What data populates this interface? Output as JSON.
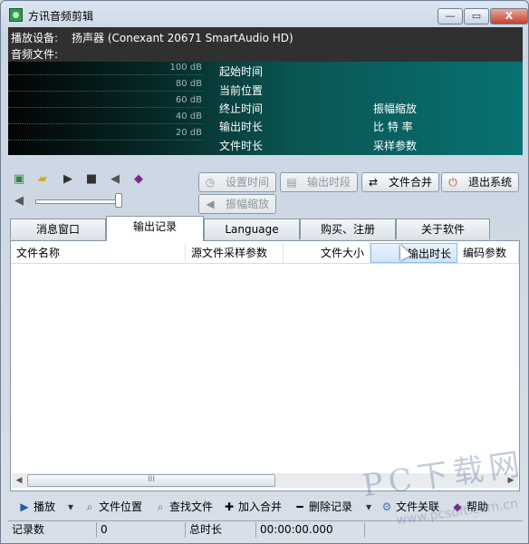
{
  "window": {
    "title": "方讯音频剪辑",
    "min_label": "—",
    "max_label": "▭",
    "close_label": "X"
  },
  "info": {
    "device_label": "播放设备:",
    "device_value": "扬声器 (Conexant 20671 SmartAudio HD)",
    "file_label": "音频文件:"
  },
  "meter": {
    "scale": [
      "100 dB",
      "80 dB",
      "60 dB",
      "40 dB",
      "20 dB"
    ],
    "left_labels": [
      "起始时间",
      "当前位置",
      "终止时间",
      "输出时长",
      "文件时长"
    ],
    "right_labels": [
      "振幅缩放",
      "比 特 率",
      "采样参数"
    ]
  },
  "toolbar": {
    "icons": [
      "monitor-icon",
      "folder-icon",
      "play-icon",
      "stop-icon",
      "speaker-icon",
      "book-icon"
    ],
    "volume_level": 0.95,
    "buttons": {
      "set_range": "设置时间段",
      "output_range": "输出时段",
      "merge": "文件合并",
      "exit": "退出系统",
      "amplitude": "振幅缩放"
    }
  },
  "tabs": [
    "消息窗口",
    "输出记录",
    "Language",
    "购买、注册",
    "关于软件"
  ],
  "active_tab": 1,
  "columns": [
    "文件名称",
    "源文件采样参数",
    "文件大小",
    "输出时长",
    "编码参数"
  ],
  "scroll_grip": "III",
  "bottom_toolbar": {
    "play": "播放",
    "file_location": "文件位置",
    "find_file": "查找文件",
    "add_merge": "加入合并",
    "delete_record": "删除记录",
    "file_assoc": "文件关联",
    "help": "帮助"
  },
  "status": {
    "record_count_label": "记录数",
    "record_count": "0",
    "total_label": "总时长",
    "total_value": "00:00:00.000"
  },
  "watermark": {
    "main": "PC下载网",
    "sub": "www.pcsoft.com.cn"
  },
  "colors": {
    "meter_start": "#040404",
    "meter_end": "#087272",
    "info_bg": "#303030"
  }
}
